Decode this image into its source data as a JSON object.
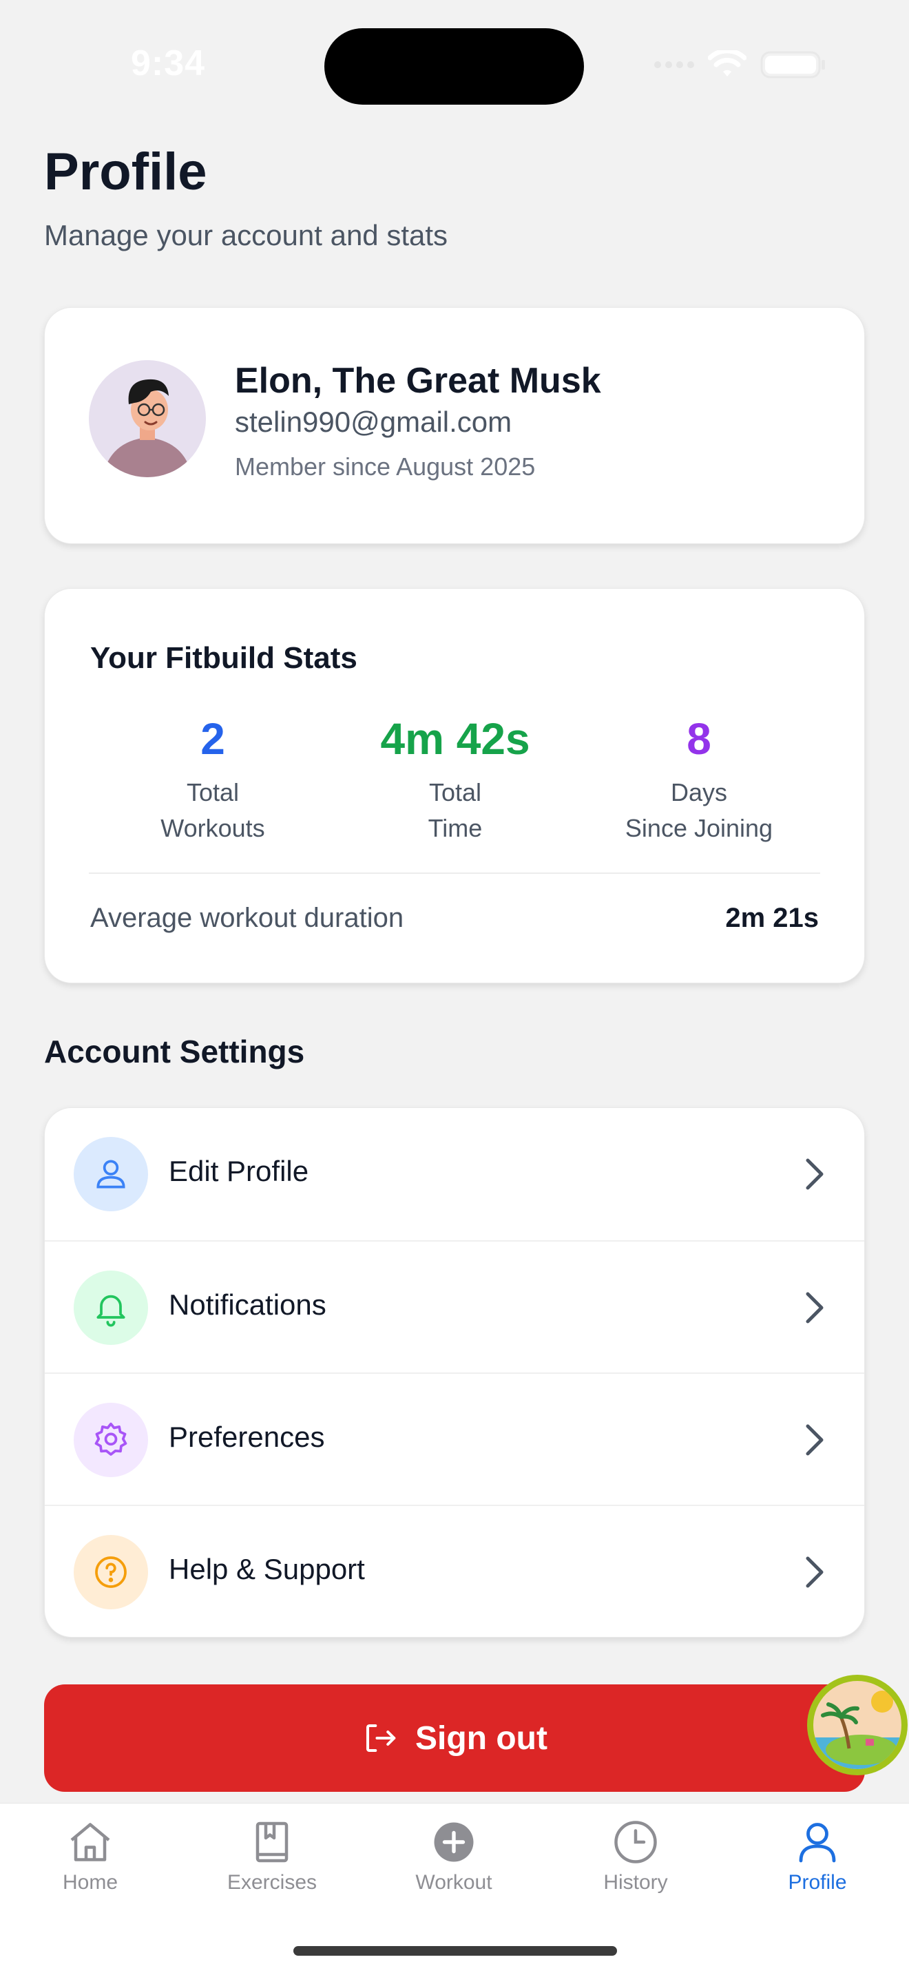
{
  "status_bar": {
    "time": "9:34"
  },
  "header": {
    "title": "Profile",
    "subtitle": "Manage your account and stats"
  },
  "profile": {
    "name": "Elon, The Great Musk",
    "email": "stelin990@gmail.com",
    "member_since": "Member since August 2025"
  },
  "stats": {
    "title": "Your Fitbuild Stats",
    "items": [
      {
        "value": "2",
        "label_line1": "Total",
        "label_line2": "Workouts",
        "color": "#2563eb"
      },
      {
        "value": "4m 42s",
        "label_line1": "Total",
        "label_line2": "Time",
        "color": "#16a34a"
      },
      {
        "value": "8",
        "label_line1": "Days",
        "label_line2": "Since Joining",
        "color": "#9333ea"
      }
    ],
    "average_label": "Average workout duration",
    "average_value": "2m 21s"
  },
  "settings": {
    "heading": "Account Settings",
    "items": [
      {
        "label": "Edit Profile",
        "icon": "user-icon",
        "icon_bg": "#dbeafe",
        "icon_color": "#3b82f6"
      },
      {
        "label": "Notifications",
        "icon": "bell-icon",
        "icon_bg": "#dcfce7",
        "icon_color": "#22c55e"
      },
      {
        "label": "Preferences",
        "icon": "gear-icon",
        "icon_bg": "#f3e8ff",
        "icon_color": "#a855f7"
      },
      {
        "label": "Help & Support",
        "icon": "help-circle-icon",
        "icon_bg": "#ffedd5",
        "icon_color": "#f59e0b"
      }
    ]
  },
  "sign_out": {
    "label": "Sign out",
    "color": "#dc2626"
  },
  "tab_bar": {
    "tabs": [
      {
        "label": "Home",
        "icon": "home-icon"
      },
      {
        "label": "Exercises",
        "icon": "book-icon"
      },
      {
        "label": "Workout",
        "icon": "plus-circle-icon"
      },
      {
        "label": "History",
        "icon": "clock-icon"
      },
      {
        "label": "Profile",
        "icon": "user-icon",
        "active": true
      }
    ],
    "active_color": "#1d6fe0",
    "inactive_color": "#8e8e93"
  }
}
